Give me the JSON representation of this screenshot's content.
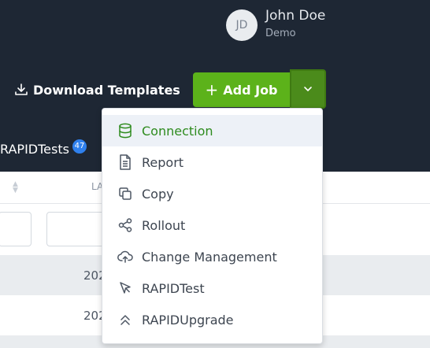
{
  "user": {
    "initials": "JD",
    "name": "John Doe",
    "role": "Demo"
  },
  "toolbar": {
    "download_label": "Download Templates",
    "add_job_label": "Add Job"
  },
  "tab": {
    "label": "RAPIDTests",
    "badge_count": "47"
  },
  "table": {
    "column_label": "LA",
    "rows": [
      {
        "cell": "202"
      },
      {
        "cell": "202"
      }
    ]
  },
  "menu": {
    "items": [
      {
        "label": "Connection",
        "icon": "database-icon",
        "active": true
      },
      {
        "label": "Report",
        "icon": "document-icon"
      },
      {
        "label": "Copy",
        "icon": "copy-icon"
      },
      {
        "label": "Rollout",
        "icon": "share-icon"
      },
      {
        "label": "Change Management",
        "icon": "cloud-upload-icon"
      },
      {
        "label": "RAPIDTest",
        "icon": "pointer-icon"
      },
      {
        "label": "RAPIDUpgrade",
        "icon": "chevrons-up-icon"
      }
    ]
  },
  "colors": {
    "topbar": "#1e2734",
    "accent_green": "#5cb21a",
    "active_text": "#2e8b1e",
    "badge_blue": "#2f80ed"
  }
}
